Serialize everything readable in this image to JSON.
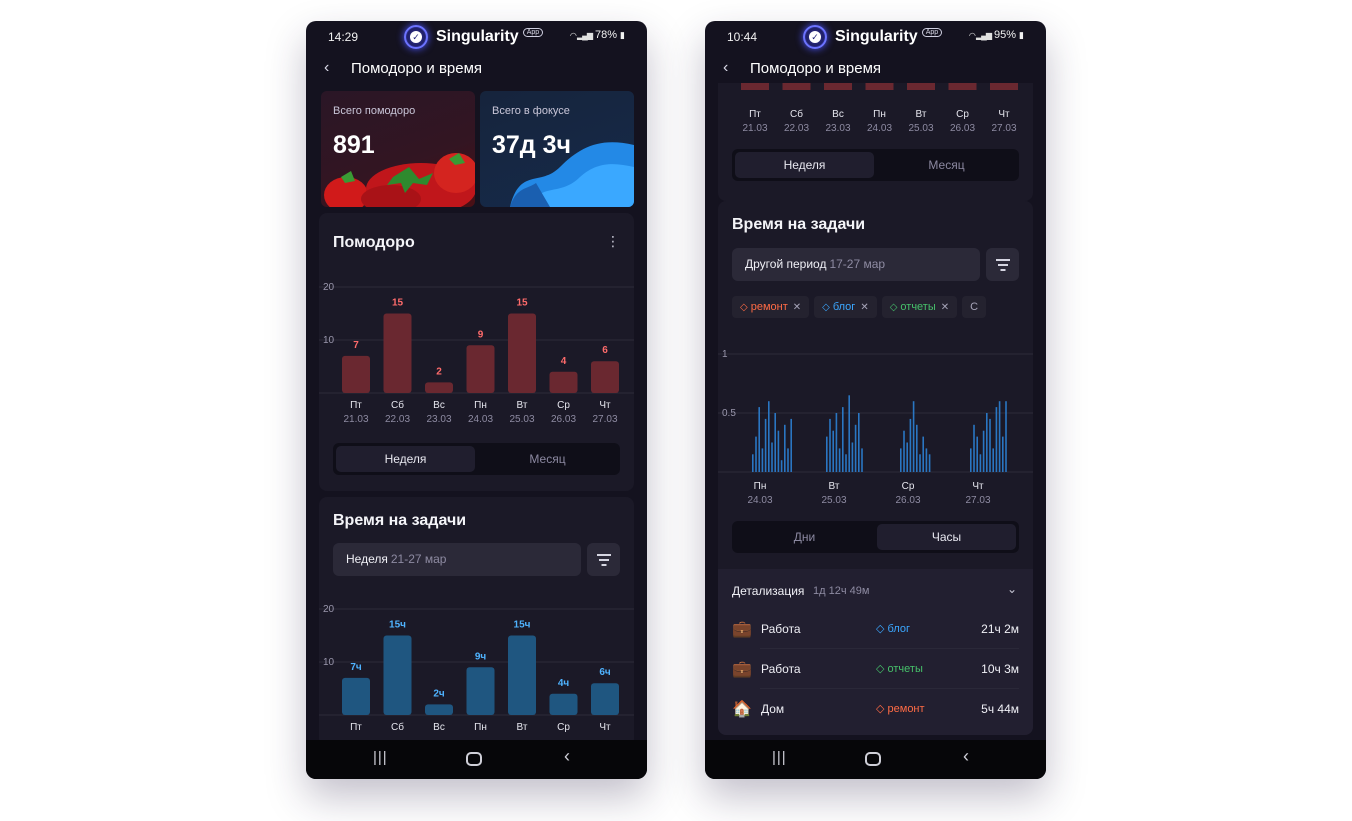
{
  "colors": {
    "pomodoro_bar": "#6a2830",
    "pomodoro_value": "#ff6b6b",
    "time_bar": "#1f5680",
    "time_value": "#4fb3ff",
    "tag_blog": "#3ba7ff",
    "tag_reports": "#46c06a",
    "tag_repair": "#ff6b45"
  },
  "left": {
    "status": {
      "time": "14:29",
      "battery": "78%"
    },
    "brand": {
      "name": "Singularity",
      "badge": "App"
    },
    "header": {
      "title": "Помодоро и время"
    },
    "tiles": [
      {
        "label": "Всего помодоро",
        "value": "891"
      },
      {
        "label": "Всего в фокусе",
        "value": "37д 3ч"
      }
    ],
    "pomodoro_card": {
      "title": "Помодоро",
      "segments": [
        "Неделя",
        "Месяц"
      ],
      "active_segment": "Неделя"
    },
    "time_card": {
      "title": "Время на задачи",
      "period_label": "Неделя",
      "period_range": "21-27 мар"
    }
  },
  "right": {
    "status": {
      "time": "10:44",
      "battery": "95%"
    },
    "brand": {
      "name": "Singularity",
      "badge": "App"
    },
    "header": {
      "title": "Помодоро и время"
    },
    "top_card": {
      "segments": [
        "Неделя",
        "Месяц"
      ],
      "active_segment": "Неделя"
    },
    "time_card": {
      "title": "Время на задачи",
      "period_label": "Другой период",
      "period_range": "17-27 мар",
      "chips": [
        {
          "label": "ремонт",
          "color": "#ff6b45"
        },
        {
          "label": "блог",
          "color": "#3ba7ff"
        },
        {
          "label": "отчеты",
          "color": "#46c06a"
        },
        {
          "label": "С",
          "color": "#a6a4b8"
        }
      ],
      "segments": [
        "Дни",
        "Часы"
      ],
      "active_segment": "Часы"
    },
    "detail": {
      "title": "Детализация",
      "total": "1д 12ч 49м",
      "rows": [
        {
          "name": "Работа",
          "icon": "briefcase-icon",
          "tag": "блог",
          "tag_color": "#3ba7ff",
          "time": "21ч 2м"
        },
        {
          "name": "Работа",
          "icon": "briefcase-icon",
          "tag": "отчеты",
          "tag_color": "#46c06a",
          "time": "10ч 3м"
        },
        {
          "name": "Дом",
          "icon": "house-icon",
          "tag": "ремонт",
          "tag_color": "#ff6b45",
          "time": "5ч 44м"
        }
      ]
    }
  },
  "chart_data": [
    {
      "type": "bar",
      "id": "pomodoro-week",
      "categories": [
        "Пт",
        "Сб",
        "Вс",
        "Пн",
        "Вт",
        "Ср",
        "Чт"
      ],
      "dates": [
        "21.03",
        "22.03",
        "23.03",
        "24.03",
        "25.03",
        "26.03",
        "27.03"
      ],
      "values": [
        7,
        15,
        2,
        9,
        15,
        4,
        6
      ],
      "labels": [
        "7",
        "15",
        "2",
        "9",
        "15",
        "4",
        "6"
      ],
      "yticks": [
        "20",
        "10"
      ],
      "ylim": [
        0,
        20
      ]
    },
    {
      "type": "bar",
      "id": "time-week",
      "categories": [
        "Пт",
        "Сб",
        "Вс",
        "Пн",
        "Вт",
        "Ср",
        "Чт"
      ],
      "dates": [
        "",
        "",
        "",
        "",
        "",
        "",
        ""
      ],
      "values": [
        7,
        15,
        2,
        9,
        15,
        4,
        6
      ],
      "labels": [
        "7ч",
        "15ч",
        "2ч",
        "9ч",
        "15ч",
        "4ч",
        "6ч"
      ],
      "yticks": [
        "20",
        "10"
      ],
      "ylim": [
        0,
        20
      ]
    },
    {
      "type": "bar",
      "id": "right-top-clipped",
      "categories": [
        "Пт",
        "Сб",
        "Вс",
        "Пн",
        "Вт",
        "Ср",
        "Чт"
      ],
      "dates": [
        "21.03",
        "22.03",
        "23.03",
        "24.03",
        "25.03",
        "26.03",
        "27.03"
      ]
    },
    {
      "type": "bar",
      "id": "hourly",
      "categories": [
        "Пн",
        "Вт",
        "Ср",
        "Чт"
      ],
      "dates": [
        "24.03",
        "25.03",
        "26.03",
        "27.03"
      ],
      "yticks": [
        "1",
        "0.5"
      ],
      "ylim": [
        0,
        1
      ],
      "groups": [
        [
          0.15,
          0.3,
          0.55,
          0.2,
          0.45,
          0.6,
          0.25,
          0.5,
          0.35,
          0.1,
          0.4,
          0.2,
          0.45
        ],
        [
          0.3,
          0.45,
          0.35,
          0.5,
          0.2,
          0.55,
          0.15,
          0.65,
          0.25,
          0.4,
          0.5,
          0.2
        ],
        [
          0.2,
          0.35,
          0.25,
          0.45,
          0.6,
          0.4,
          0.15,
          0.3,
          0.2,
          0.15
        ],
        [
          0.2,
          0.4,
          0.3,
          0.15,
          0.35,
          0.5,
          0.45,
          0.2,
          0.55,
          0.6,
          0.3,
          0.6
        ]
      ]
    }
  ]
}
